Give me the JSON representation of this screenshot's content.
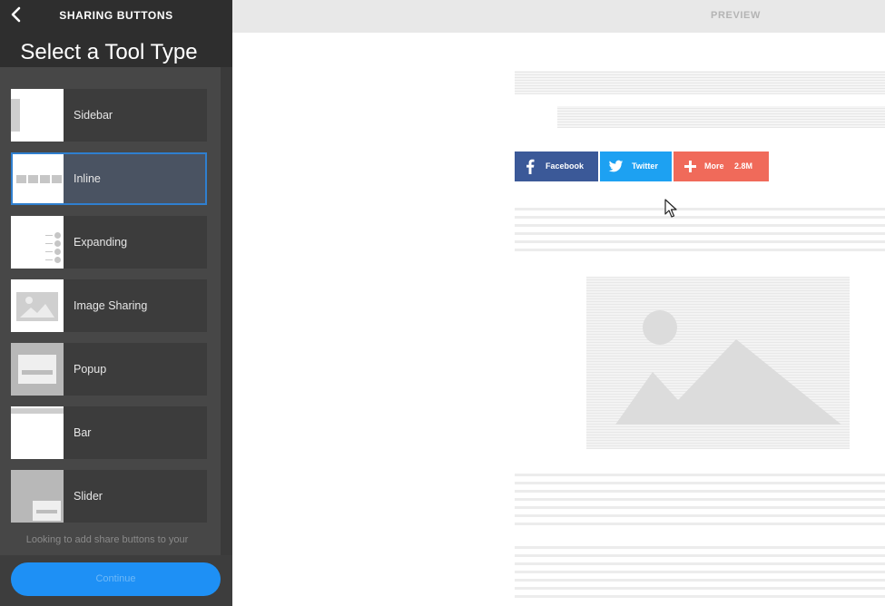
{
  "left_panel": {
    "header_title": "SHARING BUTTONS",
    "section_title": "Select a Tool Type",
    "tools": [
      {
        "label": "Sidebar",
        "active": false
      },
      {
        "label": "Inline",
        "active": true
      },
      {
        "label": "Expanding",
        "active": false
      },
      {
        "label": "Image Sharing",
        "active": false
      },
      {
        "label": "Popup",
        "active": false
      },
      {
        "label": "Bar",
        "active": false
      },
      {
        "label": "Slider",
        "active": false
      }
    ],
    "footer_note": "Looking to add share buttons to your",
    "continue_label": "Continue"
  },
  "preview": {
    "label": "PREVIEW",
    "share_buttons": {
      "facebook_label": "Facebook",
      "twitter_label": "Twitter",
      "more_label": "More",
      "more_count": "2.8M"
    }
  },
  "icons": [
    "back-arrow-icon",
    "facebook-icon",
    "twitter-icon",
    "plus-icon",
    "mouse-cursor-icon",
    "image-placeholder-icon"
  ],
  "colors": {
    "accent": "#1e90f5",
    "active_border": "#2f7fcf",
    "facebook": "#3b5998",
    "twitter": "#1da1f2",
    "more": "#f06a5a"
  }
}
